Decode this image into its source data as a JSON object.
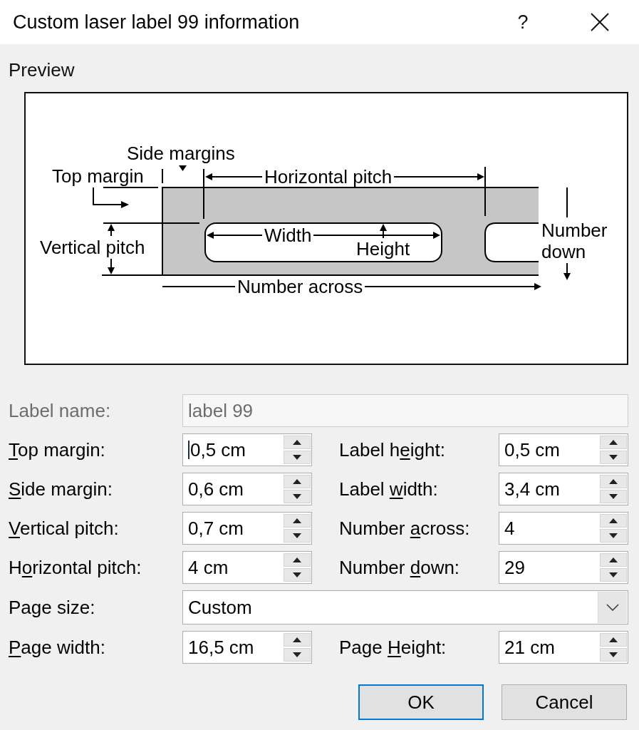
{
  "window": {
    "title": "Custom laser label 99 information",
    "help": "?"
  },
  "preview": {
    "title": "Preview",
    "labels": {
      "side_margins": "Side margins",
      "top_margin": "Top margin",
      "horizontal_pitch": "Horizontal pitch",
      "vertical_pitch": "Vertical pitch",
      "width": "Width",
      "height": "Height",
      "number_down": "Number down",
      "number_across": "Number across"
    }
  },
  "rows": [
    {
      "fields": [
        {
          "kind": "text",
          "label": [
            {
              "text": "Label name:",
              "underline": false
            }
          ],
          "value": "label 99",
          "disabled": true,
          "focused": false
        }
      ]
    },
    {
      "fields": [
        {
          "kind": "spin",
          "label": [
            {
              "text": "T",
              "underline": true
            },
            {
              "text": "op margin:",
              "underline": false
            }
          ],
          "value": "0,5 cm",
          "disabled": false,
          "focused": true
        },
        {
          "kind": "spin",
          "label": [
            {
              "text": "Label h",
              "underline": false
            },
            {
              "text": "e",
              "underline": true
            },
            {
              "text": "ight:",
              "underline": false
            }
          ],
          "value": "0,5 cm",
          "disabled": false,
          "focused": false
        }
      ]
    },
    {
      "fields": [
        {
          "kind": "spin",
          "label": [
            {
              "text": "S",
              "underline": true
            },
            {
              "text": "ide margin:",
              "underline": false
            }
          ],
          "value": "0,6 cm",
          "disabled": false,
          "focused": false
        },
        {
          "kind": "spin",
          "label": [
            {
              "text": "Label ",
              "underline": false
            },
            {
              "text": "w",
              "underline": true
            },
            {
              "text": "idth:",
              "underline": false
            }
          ],
          "value": "3,4 cm",
          "disabled": false,
          "focused": false
        }
      ]
    },
    {
      "fields": [
        {
          "kind": "spin",
          "label": [
            {
              "text": "V",
              "underline": true
            },
            {
              "text": "ertical pitch:",
              "underline": false
            }
          ],
          "value": "0,7 cm",
          "disabled": false,
          "focused": false
        },
        {
          "kind": "spin",
          "label": [
            {
              "text": "Number ",
              "underline": false
            },
            {
              "text": "a",
              "underline": true
            },
            {
              "text": "cross:",
              "underline": false
            }
          ],
          "value": "4",
          "disabled": false,
          "focused": false
        }
      ]
    },
    {
      "fields": [
        {
          "kind": "spin",
          "label": [
            {
              "text": "H",
              "underline": false
            },
            {
              "text": "o",
              "underline": true
            },
            {
              "text": "rizontal pitch:",
              "underline": false
            }
          ],
          "value": "4 cm",
          "disabled": false,
          "focused": false
        },
        {
          "kind": "spin",
          "label": [
            {
              "text": "Number ",
              "underline": false
            },
            {
              "text": "d",
              "underline": true
            },
            {
              "text": "own:",
              "underline": false
            }
          ],
          "value": "29",
          "disabled": false,
          "focused": false
        }
      ]
    },
    {
      "fields": [
        {
          "kind": "dropdown",
          "label": [
            {
              "text": "Page size:",
              "underline": false
            }
          ],
          "value": "Custom",
          "disabled": false,
          "focused": false
        }
      ]
    },
    {
      "fields": [
        {
          "kind": "spin",
          "label": [
            {
              "text": "P",
              "underline": true
            },
            {
              "text": "age width:",
              "underline": false
            }
          ],
          "value": "16,5 cm",
          "disabled": false,
          "focused": false
        },
        {
          "kind": "spin",
          "label": [
            {
              "text": "Page ",
              "underline": false
            },
            {
              "text": "H",
              "underline": true
            },
            {
              "text": "eight:",
              "underline": false
            }
          ],
          "value": "21 cm",
          "disabled": false,
          "focused": false
        }
      ]
    }
  ],
  "buttons": [
    {
      "label": "OK",
      "default": true
    },
    {
      "label": "Cancel",
      "default": false
    }
  ]
}
